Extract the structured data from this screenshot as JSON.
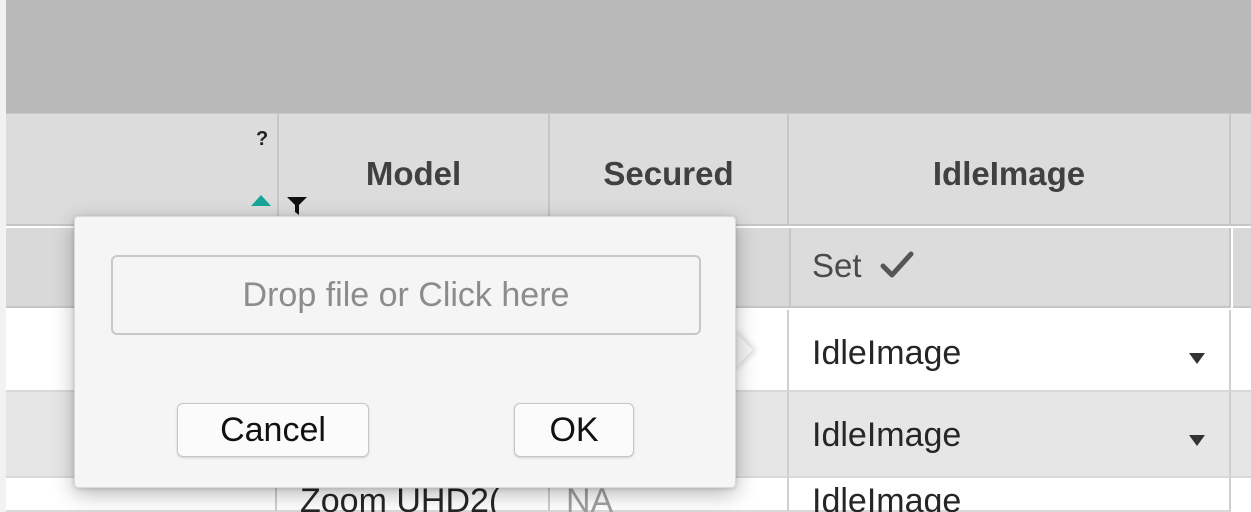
{
  "table": {
    "help_marker": "?",
    "columns": [
      {
        "label": ""
      },
      {
        "label": "Model"
      },
      {
        "label": "Secured"
      },
      {
        "label": "IdleImage"
      }
    ],
    "idleimage_filter": {
      "label": "Set"
    },
    "rows": [
      {
        "idle_image": "IdleImage"
      },
      {
        "idle_image": "IdleImage"
      }
    ],
    "partial_row": {
      "model": "Zoom UHD2(",
      "secured": "NA",
      "idle_image": "IdleImage"
    }
  },
  "file_popover": {
    "drop_placeholder": "Drop file or Click here",
    "cancel_label": "Cancel",
    "ok_label": "OK"
  },
  "icons": {
    "sort": "sort-ascending-icon",
    "filter": "filter-funnel-icon",
    "check": "checkmark-icon",
    "caret": "dropdown-caret-icon"
  },
  "colors": {
    "header_band": "#b9b9b9",
    "sort_accent": "#17a59a",
    "selected_row": "#e6e6e6"
  }
}
